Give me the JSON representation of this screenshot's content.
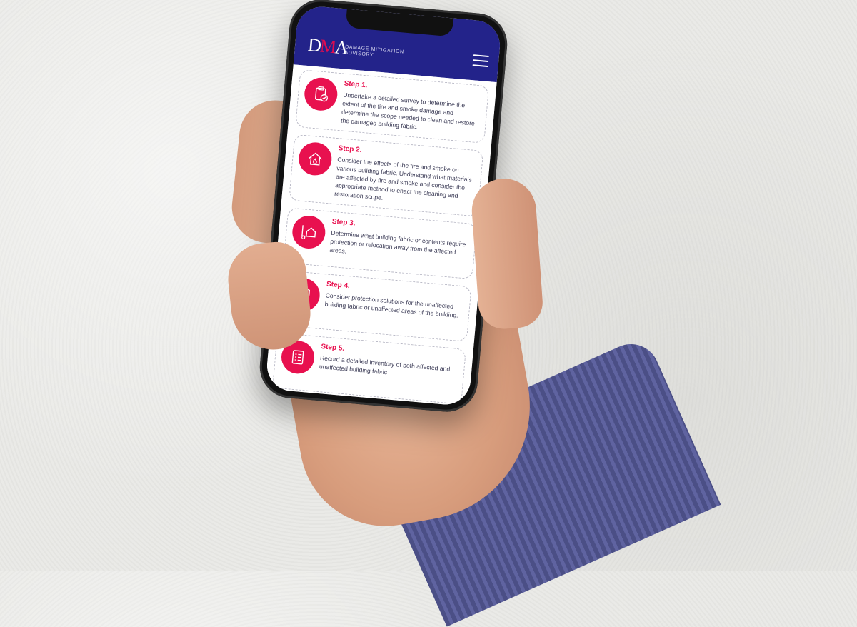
{
  "brand": {
    "logo_letters": [
      "D",
      "M",
      "A"
    ],
    "tagline_line1": "DAMAGE MITIGATION",
    "tagline_line2": "ADVISORY",
    "colors": {
      "navy": "#23238a",
      "accent": "#e8114f"
    }
  },
  "header": {
    "menu_icon": "hamburger-menu-icon"
  },
  "steps": [
    {
      "title": "Step 1.",
      "text": "Undertake a detailed survey to determine the extent of the fire and smoke damage and determine the scope needed to clean and restore the damaged building fabric.",
      "icon": "clipboard-check-icon"
    },
    {
      "title": "Step 2.",
      "text": "Consider the effects of the fire and smoke on various building fabric. Understand what materials are affected by fire and smoke and consider the appropriate method to enact the cleaning and restoration scope.",
      "icon": "house-fire-icon"
    },
    {
      "title": "Step 3.",
      "text": "Determine what building fabric or contents require protection or relocation away from the affected areas.",
      "icon": "hand-truck-house-icon"
    },
    {
      "title": "Step 4.",
      "text": "Consider protection solutions for the unaffected building fabric or unaffected areas of the building.",
      "icon": "shield-flame-icon"
    },
    {
      "title": "Step 5.",
      "text": "Record a detailed inventory of both affected and unaffected building fabric",
      "icon": "checklist-icon"
    }
  ]
}
